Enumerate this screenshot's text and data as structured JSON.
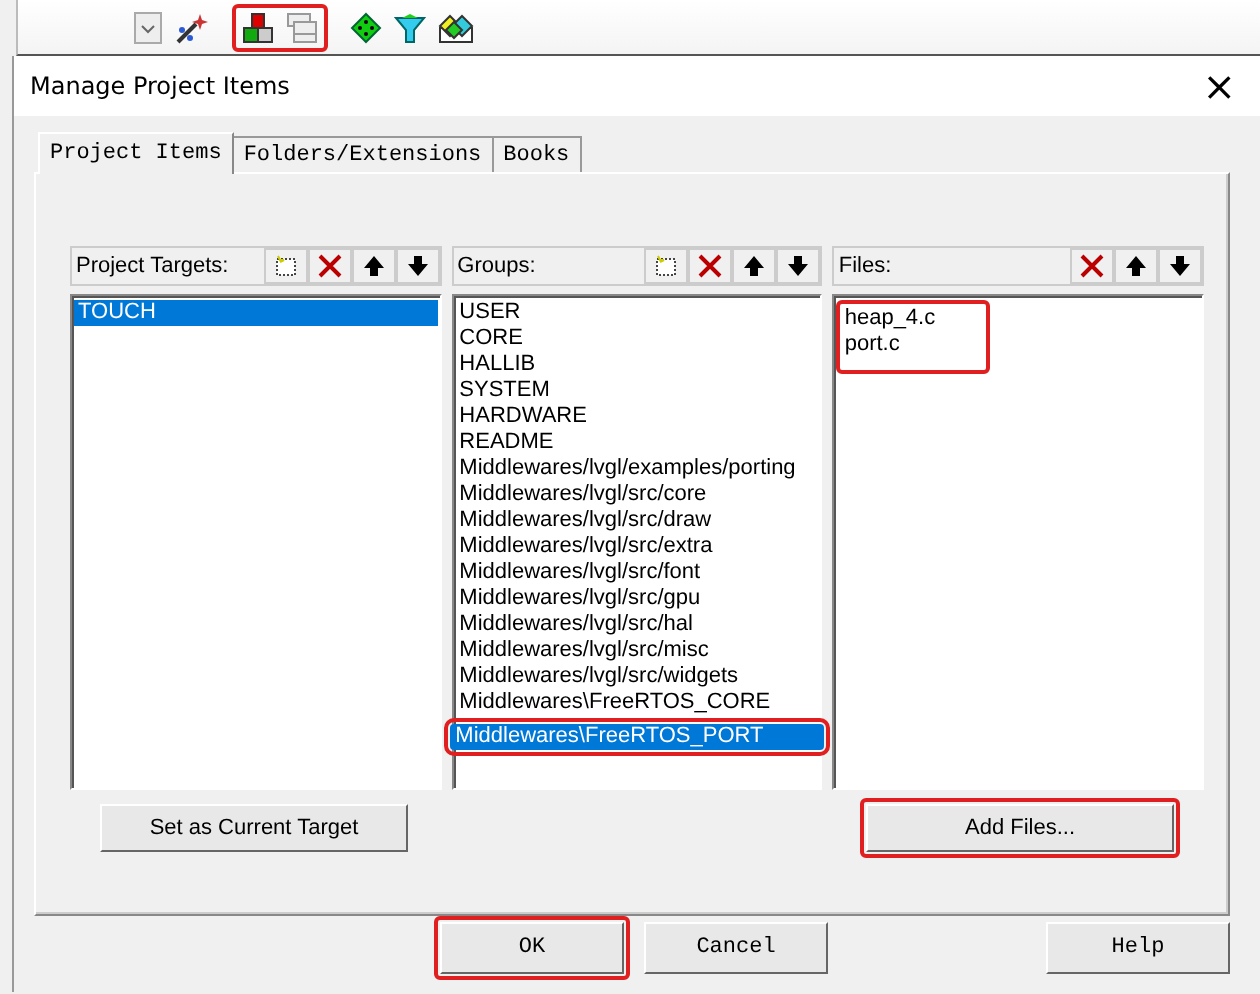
{
  "toolbar_groups": [
    {
      "highlighted": false,
      "icons": [
        {
          "kind": "dropdown"
        },
        {
          "kind": "wizard"
        }
      ]
    },
    {
      "highlighted": true,
      "icons": [
        {
          "kind": "components"
        },
        {
          "kind": "batch"
        }
      ]
    },
    {
      "highlighted": false,
      "icons": [
        {
          "kind": "diamond"
        },
        {
          "kind": "funnel"
        },
        {
          "kind": "packs"
        }
      ]
    }
  ],
  "window": {
    "title": "Manage Project Items",
    "close": "×"
  },
  "tabs": [
    {
      "label": "Project Items",
      "selected": true
    },
    {
      "label": "Folders/Extensions",
      "selected": false
    },
    {
      "label": "Books",
      "selected": false
    }
  ],
  "panels": [
    {
      "title": "Project Targets:",
      "tools": [
        {
          "kind": "new"
        },
        {
          "kind": "delete"
        },
        {
          "kind": "up"
        },
        {
          "kind": "down"
        }
      ],
      "highlighted": false,
      "items": [
        {
          "label": "TOUCH",
          "selected": true,
          "highlighted": false
        }
      ]
    },
    {
      "title": "Groups:",
      "tools": [
        {
          "kind": "new"
        },
        {
          "kind": "delete"
        },
        {
          "kind": "up"
        },
        {
          "kind": "down"
        }
      ],
      "highlighted": false,
      "items": [
        {
          "label": "USER",
          "selected": false,
          "highlighted": false
        },
        {
          "label": "CORE",
          "selected": false,
          "highlighted": false
        },
        {
          "label": "HALLIB",
          "selected": false,
          "highlighted": false
        },
        {
          "label": "SYSTEM",
          "selected": false,
          "highlighted": false
        },
        {
          "label": "HARDWARE",
          "selected": false,
          "highlighted": false
        },
        {
          "label": "README",
          "selected": false,
          "highlighted": false
        },
        {
          "label": "Middlewares/lvgl/examples/porting",
          "selected": false,
          "highlighted": false
        },
        {
          "label": "Middlewares/lvgl/src/core",
          "selected": false,
          "highlighted": false
        },
        {
          "label": "Middlewares/lvgl/src/draw",
          "selected": false,
          "highlighted": false
        },
        {
          "label": "Middlewares/lvgl/src/extra",
          "selected": false,
          "highlighted": false
        },
        {
          "label": "Middlewares/lvgl/src/font",
          "selected": false,
          "highlighted": false
        },
        {
          "label": "Middlewares/lvgl/src/gpu",
          "selected": false,
          "highlighted": false
        },
        {
          "label": "Middlewares/lvgl/src/hal",
          "selected": false,
          "highlighted": false
        },
        {
          "label": "Middlewares/lvgl/src/misc",
          "selected": false,
          "highlighted": false
        },
        {
          "label": "Middlewares/lvgl/src/widgets",
          "selected": false,
          "highlighted": false
        },
        {
          "label": "Middlewares\\FreeRTOS_CORE",
          "selected": false,
          "highlighted": false
        },
        {
          "label": "Middlewares\\FreeRTOS_PORT",
          "selected": true,
          "highlighted": true
        }
      ]
    },
    {
      "title": "Files:",
      "tools": [
        {
          "kind": "delete"
        },
        {
          "kind": "up"
        },
        {
          "kind": "down"
        }
      ],
      "highlighted": true,
      "items": [
        {
          "label": "heap_4.c",
          "selected": false,
          "highlighted": false
        },
        {
          "label": "port.c",
          "selected": false,
          "highlighted": false
        }
      ]
    }
  ],
  "panel_buttons": [
    {
      "label": "Set as Current Target",
      "highlighted": false
    },
    {
      "label": "Add Files...",
      "highlighted": true
    }
  ],
  "dialog_buttons": [
    {
      "label": "OK",
      "highlighted": true
    },
    {
      "label": "Cancel",
      "highlighted": false
    },
    {
      "label": "Help",
      "highlighted": false
    }
  ]
}
